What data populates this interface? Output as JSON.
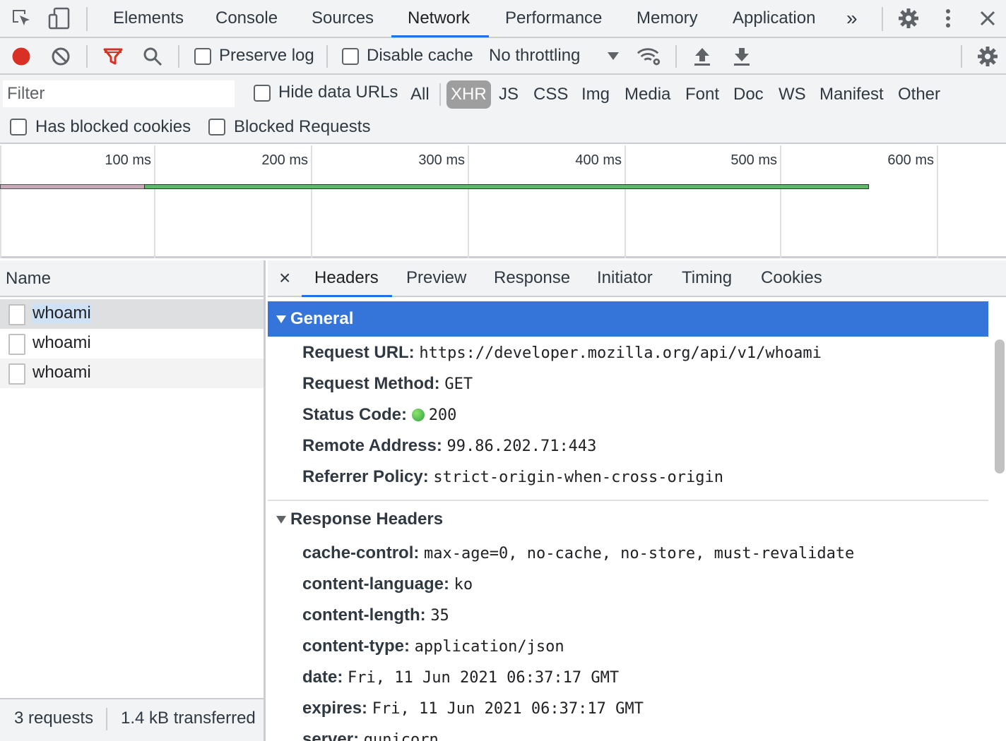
{
  "topbar": {
    "tabs": [
      "Elements",
      "Console",
      "Sources",
      "Network",
      "Performance",
      "Memory",
      "Application"
    ],
    "active_tab": "Network",
    "more_tabs": "»"
  },
  "toolbar": {
    "preserve_log": "Preserve log",
    "disable_cache": "Disable cache",
    "throttling": "No throttling"
  },
  "filterbar": {
    "filter_placeholder": "Filter",
    "hide_data_urls": "Hide data URLs",
    "types": [
      "All",
      "XHR",
      "JS",
      "CSS",
      "Img",
      "Media",
      "Font",
      "Doc",
      "WS",
      "Manifest",
      "Other"
    ],
    "selected_type": "XHR",
    "has_blocked_cookies": "Has blocked cookies",
    "blocked_requests": "Blocked Requests"
  },
  "overview": {
    "ticks": [
      "100 ms",
      "200 ms",
      "300 ms",
      "400 ms",
      "500 ms",
      "600 ms"
    ]
  },
  "requests": {
    "column_header": "Name",
    "rows": [
      "whoami",
      "whoami",
      "whoami"
    ],
    "summary_count": "3 requests",
    "summary_transferred": "1.4 kB transferred"
  },
  "detail": {
    "close": "×",
    "tabs": [
      "Headers",
      "Preview",
      "Response",
      "Initiator",
      "Timing",
      "Cookies"
    ],
    "active_tab": "Headers",
    "general": {
      "title": "General",
      "rows": [
        {
          "key": "Request URL:",
          "value": "https://developer.mozilla.org/api/v1/whoami"
        },
        {
          "key": "Request Method:",
          "value": "GET"
        },
        {
          "key": "Status Code:",
          "value": "200"
        },
        {
          "key": "Remote Address:",
          "value": "99.86.202.71:443"
        },
        {
          "key": "Referrer Policy:",
          "value": "strict-origin-when-cross-origin"
        }
      ]
    },
    "response_headers": {
      "title": "Response Headers",
      "rows": [
        {
          "key": "cache-control:",
          "value": "max-age=0, no-cache, no-store, must-revalidate"
        },
        {
          "key": "content-language:",
          "value": "ko"
        },
        {
          "key": "content-length:",
          "value": "35"
        },
        {
          "key": "content-type:",
          "value": "application/json"
        },
        {
          "key": "date:",
          "value": "Fri, 11 Jun 2021 06:37:17 GMT"
        },
        {
          "key": "expires:",
          "value": "Fri, 11 Jun 2021 06:37:17 GMT"
        },
        {
          "key": "server:",
          "value": "gunicorn"
        }
      ]
    }
  },
  "colors": {
    "accent": "#1a73e8",
    "selected_section": "#3574d9",
    "record": "#d93025",
    "filter_active": "#d93025",
    "timeline_bar": "#4caf50"
  }
}
